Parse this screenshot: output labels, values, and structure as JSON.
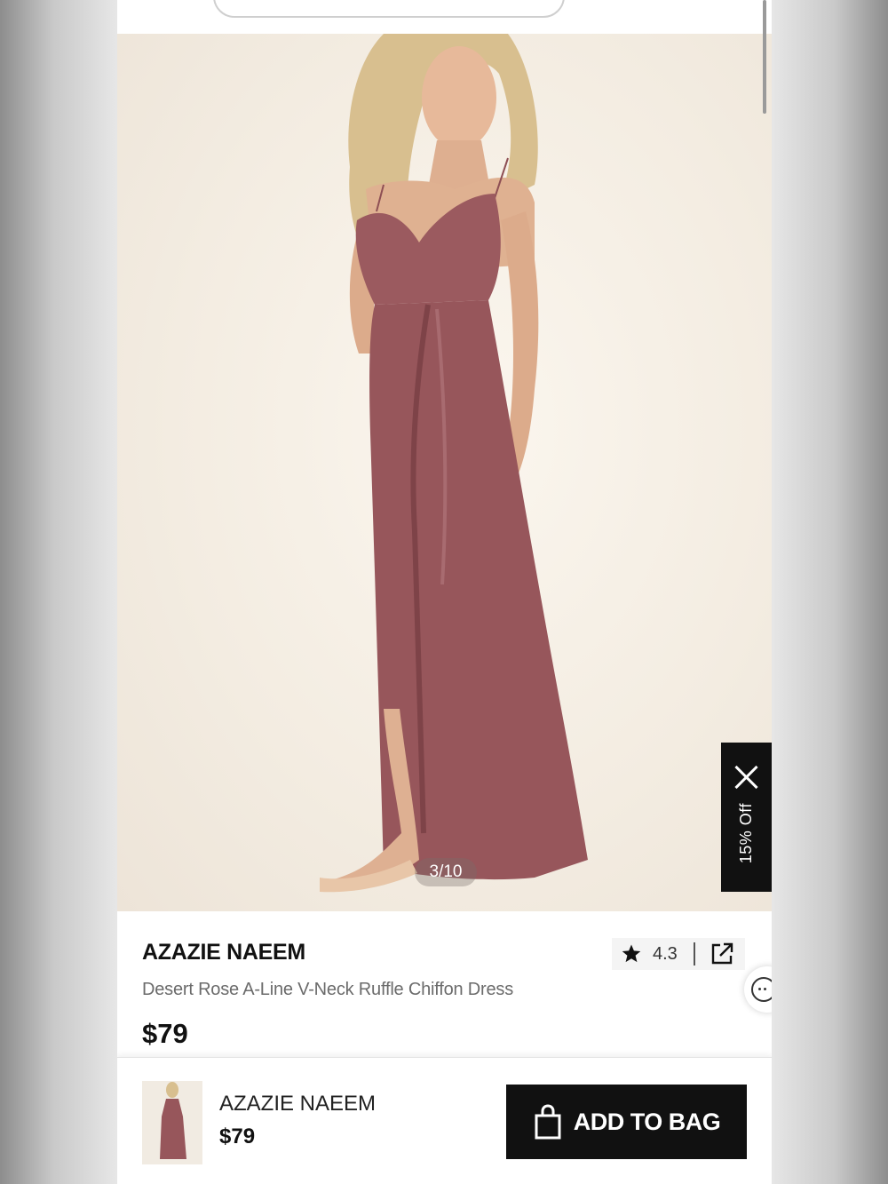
{
  "colors": {
    "dress": "#9b5a5f",
    "accent": "#111111"
  },
  "gallery": {
    "counter": "3/10"
  },
  "promo": {
    "label": "15% Off"
  },
  "product": {
    "brand": "AZAZIE NAEEM",
    "name": "Desert Rose A-Line V-Neck Ruffle Chiffon Dress",
    "price": "$79",
    "rating": "4.3"
  },
  "bottom_bar": {
    "brand": "AZAZIE NAEEM",
    "price": "$79",
    "add_to_bag_label": "ADD TO BAG"
  },
  "icons": [
    "star-icon",
    "share-icon",
    "close-icon",
    "chat-icon",
    "bag-icon"
  ]
}
